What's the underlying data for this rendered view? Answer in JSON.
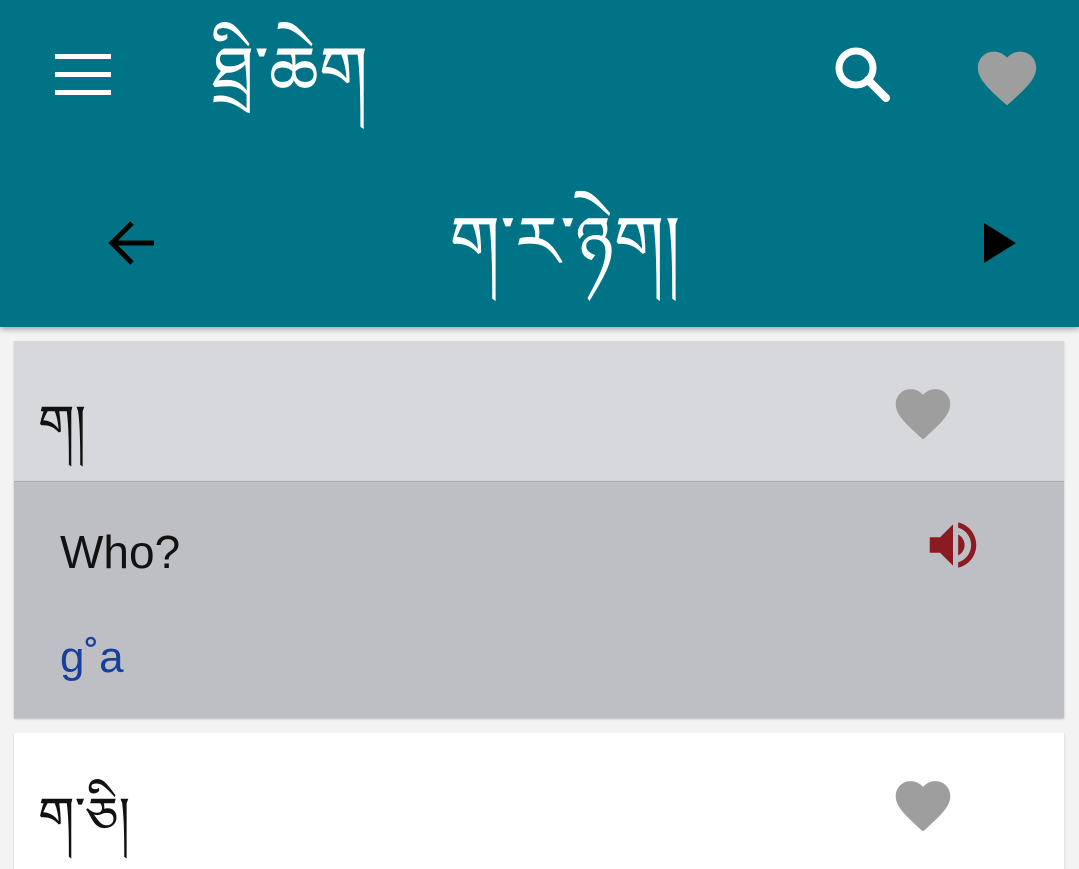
{
  "app": {
    "title": "ཐྲི་ཆེག"
  },
  "toolbar": {
    "menu_icon": "menu-icon",
    "search_icon": "search-icon",
    "favorite_icon": "heart-icon"
  },
  "section": {
    "title": "ག་ར་ཉེག།",
    "back_icon": "arrow-left-icon",
    "play_icon": "play-icon"
  },
  "entries": [
    {
      "word": "ག།",
      "expanded": true,
      "translation": "Who?",
      "phonetic": "g˚a",
      "favorite_icon": "heart-icon",
      "audio_icon": "speaker-icon",
      "audio_color": "#8b1b22"
    },
    {
      "word": "ག་ཅི།",
      "expanded": false,
      "favorite_icon": "heart-icon"
    }
  ],
  "colors": {
    "toolbar_bg": "#007386",
    "heart": "#9e9e9e",
    "expanded_header_bg": "#d7d8db",
    "detail_bg": "#bdbfc5",
    "phonetic": "#17409a"
  }
}
